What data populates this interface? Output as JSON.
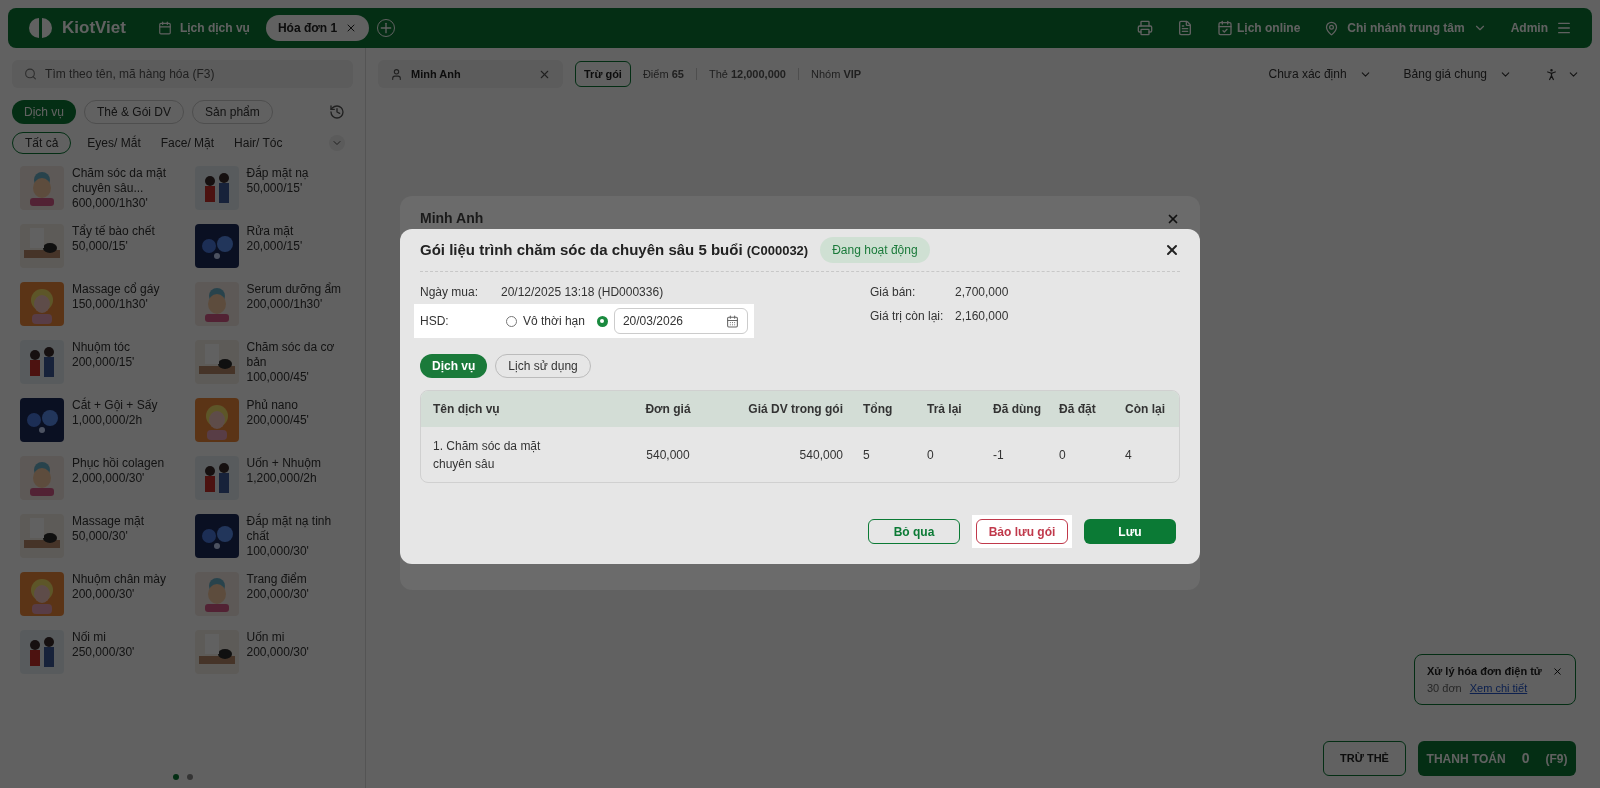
{
  "topbar": {
    "logo": "KiotViet",
    "tabs": [
      {
        "label": "Lịch dịch vụ",
        "selected": false,
        "kind": "calendar"
      },
      {
        "label": "Hóa đơn 1",
        "selected": true,
        "kind": "invoice"
      }
    ],
    "online": "Lịch online",
    "branch": "Chi nhánh trung tâm",
    "user": "Admin"
  },
  "search": {
    "placeholder": "Tìm theo tên, mã hàng hóa (F3)"
  },
  "customer": {
    "name": "Minh Anh",
    "deduct_button": "Trừ gói",
    "points_label": "Điểm",
    "points": "65",
    "card_label": "Thẻ",
    "card": "12,000,000",
    "group_label": "Nhóm",
    "group": "VIP"
  },
  "right_selects": [
    "Chưa xác định",
    "Bảng giá chung"
  ],
  "category_tabs": [
    {
      "label": "Dịch vụ",
      "selected": true
    },
    {
      "label": "Thẻ & Gói DV",
      "selected": false
    },
    {
      "label": "Sản phẩm",
      "selected": false
    }
  ],
  "filters": [
    {
      "label": "Tất cả",
      "selected": true
    },
    {
      "label": "Eyes/ Mắt",
      "selected": false
    },
    {
      "label": "Face/ Mặt",
      "selected": false
    },
    {
      "label": "Hair/ Tóc",
      "selected": false
    }
  ],
  "products": [
    {
      "name": "Chăm sóc da mặt chuyên sâu...",
      "price": "600,000/1h30'"
    },
    {
      "name": "Đắp mặt nạ",
      "price": "50,000/15'"
    },
    {
      "name": "Tẩy tế bào chết",
      "price": "50,000/15'"
    },
    {
      "name": "Rửa mặt",
      "price": "20,000/15'"
    },
    {
      "name": "Massage cổ gáy",
      "price": "150,000/1h30'"
    },
    {
      "name": "Serum dưỡng ẩm",
      "price": "200,000/1h30'"
    },
    {
      "name": "Nhuộm tóc",
      "price": "200,000/15'"
    },
    {
      "name": "Chăm sóc da cơ bản",
      "price": "100,000/45'"
    },
    {
      "name": "Cắt + Gội + Sấy",
      "price": "1,000,000/2h"
    },
    {
      "name": "Phủ nano",
      "price": "200,000/45'"
    },
    {
      "name": "Phục hồi colagen",
      "price": "2,000,000/30'"
    },
    {
      "name": "Uốn + Nhuộm",
      "price": "1,200,000/2h"
    },
    {
      "name": "Massage mặt",
      "price": "50,000/30'"
    },
    {
      "name": "Đắp mặt nạ tinh chất",
      "price": "100,000/30'"
    },
    {
      "name": "Nhuộm chân mày",
      "price": "200,000/30'"
    },
    {
      "name": "Trang điểm",
      "price": "200,000/30'"
    },
    {
      "name": "Nối mi",
      "price": "250,000/30'"
    },
    {
      "name": "Uốn mi",
      "price": "200,000/30'"
    }
  ],
  "pages": [
    {
      "selected": true
    },
    {
      "selected": false
    }
  ],
  "toast": {
    "title": "Xử lý hóa đơn điện tử",
    "count": "30 đơn",
    "link": "Xem chi tiết"
  },
  "actions": {
    "deduct_card": "TRỪ THẺ",
    "pay": "THANH TOÁN",
    "total": "0",
    "shortcut": "(F9)"
  },
  "back_dialog": {
    "title": "Minh Anh"
  },
  "dialog": {
    "title": "Gói liệu trình chăm sóc da chuyên sâu 5 buổi",
    "code": "(C000032)",
    "status": "Đang hoạt động",
    "purchase_label": "Ngày mua:",
    "purchase": "20/12/2025 13:18 (HD000336)",
    "expiry_label": "HSD:",
    "expiry_options": [
      {
        "kind": "text",
        "label": "Vô thời hạn",
        "selected": false
      },
      {
        "kind": "date",
        "value": "20/03/2026",
        "selected": true
      }
    ],
    "price_label": "Giá bán:",
    "price": "2,700,000",
    "remaining_label": "Giá trị còn lại:",
    "remaining": "2,160,000",
    "tabs": [
      {
        "label": "Dịch vụ",
        "selected": true
      },
      {
        "label": "Lịch sử dụng",
        "selected": false
      }
    ],
    "table": {
      "columns": [
        "Tên dịch vụ",
        "Đơn giá",
        "Giá DV trong gói",
        "Tổng",
        "Trả lại",
        "Đã dùng",
        "Đã đặt",
        "Còn lại"
      ],
      "rows": [
        [
          "1. Chăm sóc da mặt chuyên sâu",
          "540,000",
          "540,000",
          "5",
          "0",
          "-1",
          "0",
          "4"
        ]
      ]
    },
    "buttons": [
      {
        "kind": "cancel",
        "label": "Bỏ qua"
      },
      {
        "kind": "reserve",
        "label": "Bảo lưu gói"
      },
      {
        "kind": "save",
        "label": "Lưu"
      }
    ]
  }
}
